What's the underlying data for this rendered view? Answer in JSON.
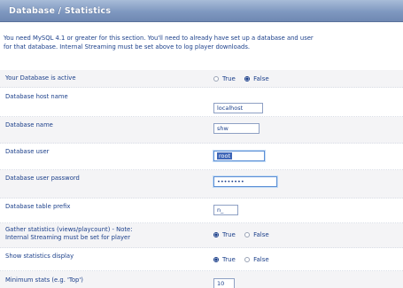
{
  "panel": {
    "title": "Database / Statistics"
  },
  "notice": {
    "line1": "You need MySQL 4.1 or greater for this section. You'll need to already have set up a database and user",
    "line2": "for that database. Internal Streaming must be set above to log player downloads."
  },
  "settings": {
    "enabled": {
      "label": "Your Database is active",
      "options": [
        "True",
        "False"
      ],
      "selected": "False"
    },
    "host": {
      "label": "Database host name",
      "value": "localhost"
    },
    "name": {
      "label": "Database name",
      "value": "shw"
    },
    "user": {
      "label": "Database user",
      "value": "root"
    },
    "password": {
      "label": "Database user password",
      "value": "••••••••"
    },
    "prefix": {
      "label": "Database table prefix",
      "value": "n_"
    },
    "gather": {
      "label_line1": "Gather statistics (views/playcount) - Note:",
      "label_line2": "Internal Streaming must be set for player",
      "options": [
        "True",
        "False"
      ],
      "selected": "True"
    },
    "show_stats": {
      "label": "Show statistics display",
      "options": [
        "True",
        "False"
      ],
      "selected": "True"
    },
    "min_stats": {
      "label": "Minimum stats (e.g. 'Top')",
      "value": "10"
    }
  }
}
